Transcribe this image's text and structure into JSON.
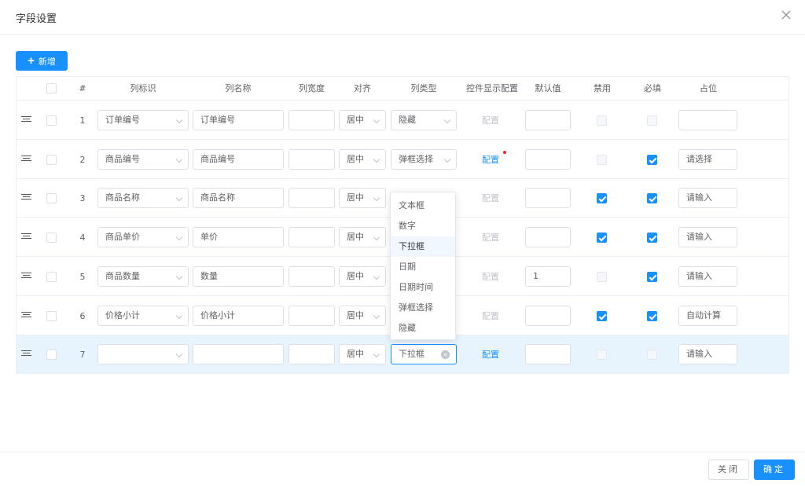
{
  "dialog": {
    "title": "字段设置",
    "close_icon": "close-icon"
  },
  "toolbar": {
    "add_label": "新增",
    "add_icon": "+"
  },
  "table": {
    "headers": {
      "index": "#",
      "field_id": "列标识",
      "col_name": "列名称",
      "col_width": "列宽度",
      "align": "对齐",
      "col_type": "列类型",
      "control_config": "控件显示配置",
      "default_value": "默认值",
      "disabled": "禁用",
      "required": "必填",
      "placeholder": "占位"
    },
    "config_label": "配置",
    "rows": [
      {
        "index": "1",
        "field_id": "订单编号",
        "col_name": "订单编号",
        "col_width": "",
        "align": "居中",
        "col_type": "隐藏",
        "config_enabled": false,
        "config_dot": false,
        "default_value": "",
        "disabled": false,
        "disabled_locked": true,
        "required": false,
        "required_locked": true,
        "placeholder": ""
      },
      {
        "index": "2",
        "field_id": "商品编号",
        "col_name": "商品编号",
        "col_width": "",
        "align": "居中",
        "col_type": "弹框选择",
        "config_enabled": true,
        "config_dot": true,
        "default_value": "",
        "disabled": false,
        "disabled_locked": true,
        "required": true,
        "required_locked": false,
        "placeholder": "请选择"
      },
      {
        "index": "3",
        "field_id": "商品名称",
        "col_name": "商品名称",
        "col_width": "",
        "align": "居中",
        "col_type": "",
        "config_enabled": false,
        "config_dot": false,
        "default_value": "",
        "disabled": true,
        "disabled_locked": false,
        "required": true,
        "required_locked": false,
        "placeholder": "请输入"
      },
      {
        "index": "4",
        "field_id": "商品单价",
        "col_name": "单价",
        "col_width": "",
        "align": "居中",
        "col_type": "",
        "config_enabled": false,
        "config_dot": false,
        "default_value": "",
        "disabled": true,
        "disabled_locked": false,
        "required": true,
        "required_locked": false,
        "placeholder": "请输入"
      },
      {
        "index": "5",
        "field_id": "商品数量",
        "col_name": "数量",
        "col_width": "",
        "align": "居中",
        "col_type": "",
        "config_enabled": false,
        "config_dot": false,
        "default_value": "1",
        "disabled": false,
        "disabled_locked": true,
        "required": true,
        "required_locked": false,
        "placeholder": "请输入"
      },
      {
        "index": "6",
        "field_id": "价格小计",
        "col_name": "价格小计",
        "col_width": "",
        "align": "居中",
        "col_type": "",
        "config_enabled": false,
        "config_dot": false,
        "default_value": "",
        "disabled": true,
        "disabled_locked": false,
        "required": true,
        "required_locked": false,
        "placeholder": "自动计算"
      },
      {
        "index": "7",
        "field_id": "",
        "col_name": "",
        "col_width": "",
        "align": "居中",
        "col_type": "下拉框",
        "config_enabled": true,
        "config_dot": false,
        "default_value": "",
        "disabled": false,
        "disabled_locked": true,
        "required": false,
        "required_locked": true,
        "placeholder": "请输入",
        "active": true
      }
    ]
  },
  "dropdown": {
    "options": [
      "文本框",
      "数字",
      "下拉框",
      "日期",
      "日期时间",
      "弹框选择",
      "隐藏"
    ],
    "highlighted": "下拉框"
  },
  "footer": {
    "close_label": "关闭",
    "ok_label": "确定"
  },
  "colors": {
    "primary": "#1890ff",
    "border": "#dcdfe6",
    "active_row": "#e8f4fd",
    "dot": "#f5222d"
  }
}
